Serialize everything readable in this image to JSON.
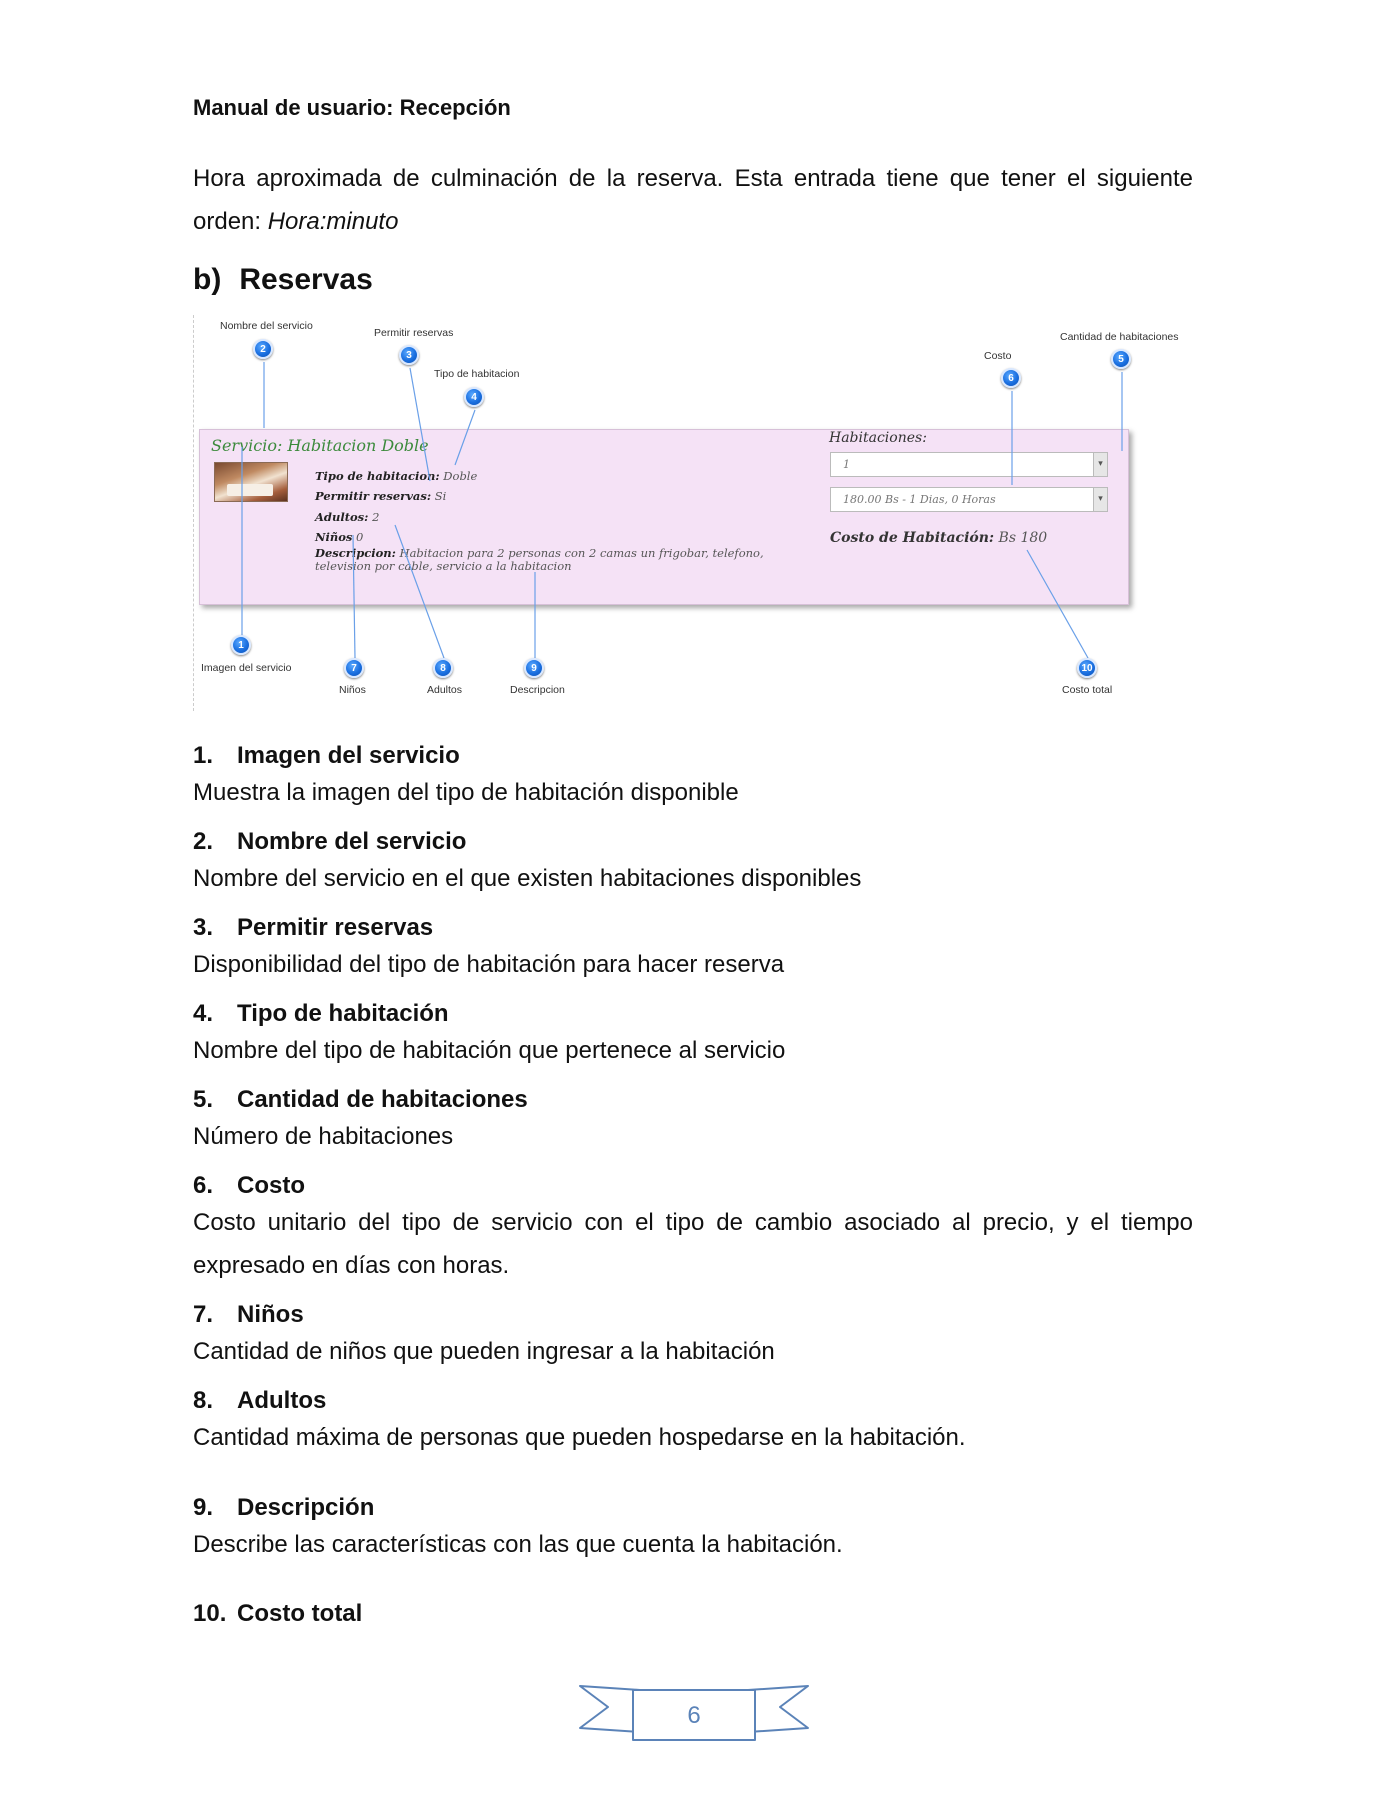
{
  "header": {
    "title": "Manual de usuario: Recepción"
  },
  "intro": {
    "text": "Hora aproximada de culminación de la reserva. Esta entrada tiene que tener el siguiente orden: ",
    "format": "Hora:minuto"
  },
  "section": {
    "letter": "b)",
    "title": "Reservas"
  },
  "screenshot": {
    "service_title": "Servicio: Habitacion Doble",
    "fields": {
      "tipo_label": "Tipo de habitacion:",
      "tipo_value": "Doble",
      "permitir_label": "Permitir reservas:",
      "permitir_value": "Si",
      "adultos_label": "Adultos:",
      "adultos_value": "2",
      "ninos_label": "Niños",
      "ninos_value": "0",
      "descripcion_label": "Descripcion:",
      "descripcion_value_1": "Habitacion para 2 personas con 2 camas un frigobar, telefono,",
      "descripcion_value_2": "television por cable, servicio a la habitacion"
    },
    "habitaciones_label": "Habitaciones:",
    "habitaciones_value": "1",
    "precio_value": "180.00 Bs - 1 Dias, 0 Horas",
    "costo_label": "Costo de Habitación:",
    "costo_value": "Bs 180",
    "callouts": [
      {
        "n": "1",
        "label": "Imagen del servicio"
      },
      {
        "n": "2",
        "label": "Nombre del servicio"
      },
      {
        "n": "3",
        "label": "Permitir reservas"
      },
      {
        "n": "4",
        "label": "Tipo de habitacion"
      },
      {
        "n": "5",
        "label": "Cantidad de habitaciones"
      },
      {
        "n": "6",
        "label": "Costo"
      },
      {
        "n": "7",
        "label": "Niños"
      },
      {
        "n": "8",
        "label": "Adultos"
      },
      {
        "n": "9",
        "label": "Descripcion"
      },
      {
        "n": "10",
        "label": "Costo total"
      }
    ]
  },
  "definitions": [
    {
      "num": "1.",
      "title": "Imagen del servicio",
      "body": "Muestra la imagen del tipo de habitación disponible"
    },
    {
      "num": "2.",
      "title": "Nombre del servicio",
      "body": "Nombre del servicio en el que existen habitaciones disponibles"
    },
    {
      "num": "3.",
      "title": "Permitir reservas",
      "body": "Disponibilidad del tipo de habitación para hacer reserva"
    },
    {
      "num": "4.",
      "title": "Tipo de habitación",
      "body": "Nombre del tipo de habitación que pertenece al servicio"
    },
    {
      "num": "5.",
      "title": "Cantidad de habitaciones",
      "body": "Número de habitaciones"
    },
    {
      "num": "6.",
      "title": "Costo",
      "body": "Costo unitario del tipo de servicio con el tipo de cambio asociado al precio, y el tiempo expresado en días con horas."
    },
    {
      "num": "7.",
      "title": "Niños",
      "body": "Cantidad de niños que pueden ingresar a la habitación"
    },
    {
      "num": "8.",
      "title": "Adultos",
      "body": "Cantidad máxima de personas que pueden hospedarse en la habitación."
    },
    {
      "num": "9.",
      "title": "Descripción",
      "body": "Describe las características con las que cuenta la habitación."
    },
    {
      "num": "10.",
      "title": "Costo total",
      "body": ""
    }
  ],
  "footer": {
    "page_number": "6"
  }
}
